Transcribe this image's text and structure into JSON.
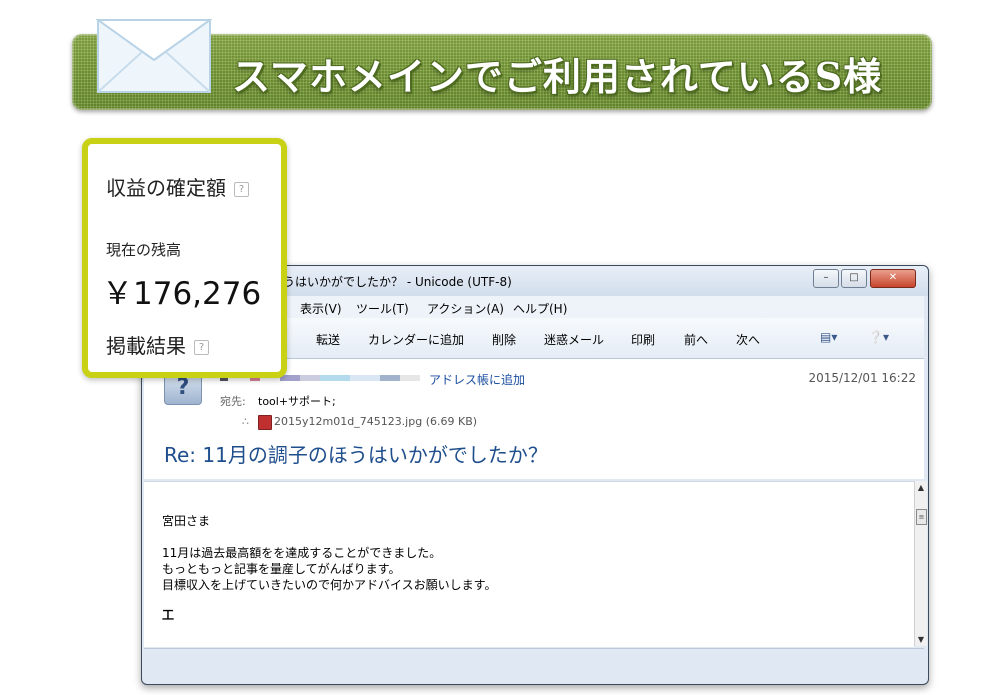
{
  "banner": {
    "title": "スマホメインでご利用されているS様",
    "icon": "envelope-icon",
    "color": "#7ea23b"
  },
  "card": {
    "title": "収益の確定額",
    "balance_label": "現在の残高",
    "balance_amount": "￥176,276",
    "results_label": "掲載結果",
    "help_glyph": "?",
    "border_color": "#c9d114"
  },
  "window": {
    "title": "うはいかがでしたか？ - Unicode (UTF-8)",
    "menu": [
      "表示(V)",
      "ツール(T)",
      "アクション(A)",
      "ヘルプ(H)"
    ],
    "toolbar": [
      "転送",
      "カレンダーに追加",
      "削除",
      "迷惑メール",
      "印刷",
      "前へ",
      "次へ"
    ],
    "address_book_link": "アドレス帳に追加",
    "datetime": "2015/12/01 16:22",
    "to_label": "宛先:",
    "to_value": "tool+サポート;",
    "attachment": "2015y12m01d_745123.jpg (6.69 KB)",
    "subject": "Re: 11月の調子のほうはいかがでしたか？",
    "body": [
      "宮田さま",
      "11月は過去最高額をを達成することができました。",
      "もっともっと記事を量産してがんばります。",
      "目標収入を上げていきたいので何かアドバイスお願いします。",
      "工"
    ]
  }
}
